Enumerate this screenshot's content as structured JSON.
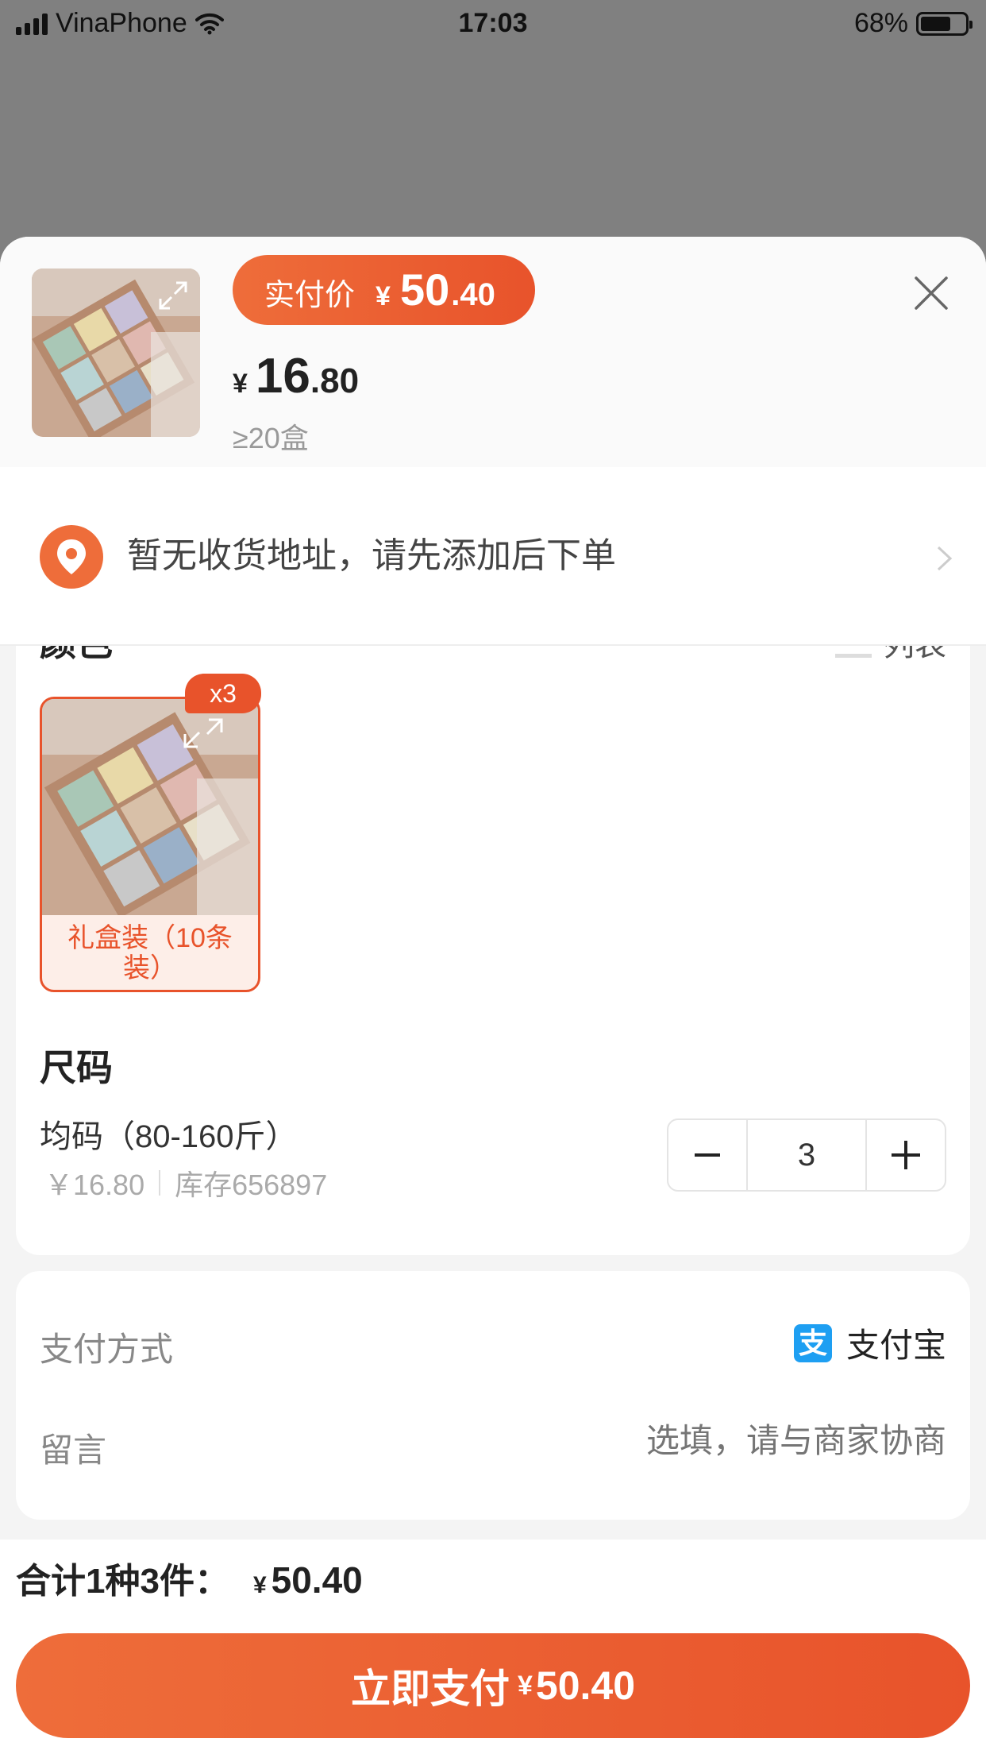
{
  "status_bar": {
    "carrier": "VinaPhone",
    "time": "17:03",
    "battery": "68%",
    "battery_level": 0.68
  },
  "product": {
    "paid_price_label": "实付价",
    "paid_price_currency": "¥",
    "paid_price_int": "50",
    "paid_price_dec": ".40",
    "unit_currency": "¥",
    "unit_price_int": "16",
    "unit_price_dec": ".80",
    "min_qty": "≥20盒"
  },
  "address": {
    "text": "暂无收货地址，请先添加后下单"
  },
  "options": {
    "color_title": "颜色",
    "list_label": "列表",
    "swatch": {
      "label": "礼盒装（10条装）",
      "qty_badge": "x3"
    },
    "size_title": "尺码",
    "size_name": "均码（80-160斤）",
    "size_price": "￥16.80",
    "size_stock": "库存656897",
    "quantity": "3"
  },
  "payment": {
    "method_label": "支付方式",
    "method_value": "支付宝",
    "alipay_glyph": "支",
    "memo_label": "留言",
    "memo_placeholder": "选填，请与商家协商"
  },
  "footer": {
    "total_label": "合计1种3件：",
    "total_currency": "¥",
    "total_value": "50.40",
    "pay_label": "立即支付",
    "pay_currency": "¥",
    "pay_value": "50.40"
  },
  "colors": {
    "accent": "#E8532B",
    "accent_light": "#EE6D3A",
    "alipay": "#1E9FF2"
  }
}
